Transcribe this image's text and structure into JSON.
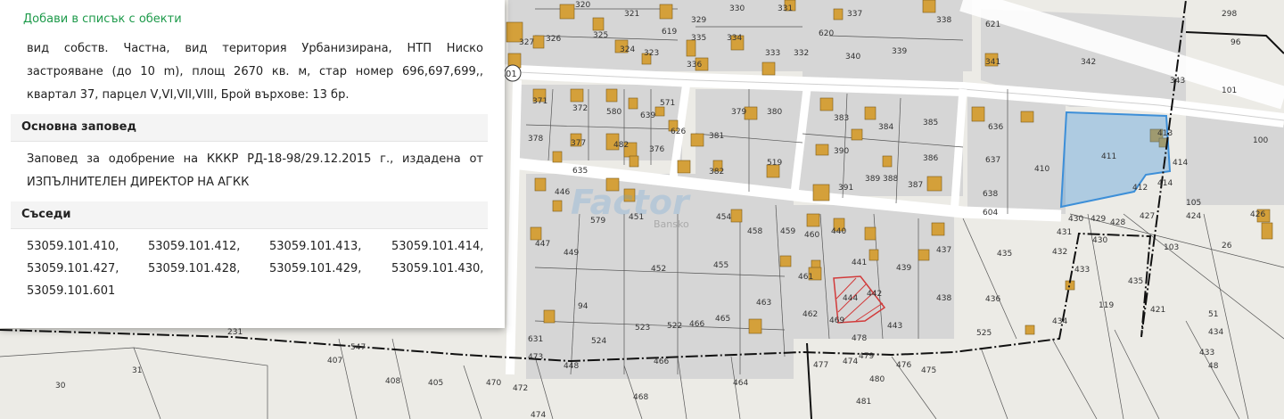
{
  "panel": {
    "add_link": "Добави в списък с обекти",
    "description": "вид собств. Частна, вид територия Урбанизирана, НТП Ниско застрояване (до 10 m), площ 2670 кв. м, стар номер 696,697,699,, квартал 37, парцел V,VI,VII,VIII, Брой върхове: 13 бр.",
    "order_heading": "Основна заповед",
    "order_text": "Заповед за одобрение на КККР РД-18-98/29.12.2015 г., издадена от ИЗПЪЛНИТЕЛЕН ДИРЕКТОР НА АГКК",
    "neighbors_heading": "Съседи",
    "neighbors": [
      "53059.101.410,",
      "53059.101.412,",
      "53059.101.413,",
      "53059.101.414,",
      "53059.101.427,",
      "53059.101.428,",
      "53059.101.429,",
      "53059.101.430,",
      "53059.101.601"
    ]
  },
  "map": {
    "watermark": "Factor",
    "watermark_sub": "Bansko",
    "road_label": "01",
    "colors": {
      "background": "#ecebe6",
      "building": "#d4a03a",
      "selected": "#3d8fd8",
      "highlight": "#d23a3a",
      "boundary": "#111111",
      "block": "#d3d3d3"
    }
  }
}
